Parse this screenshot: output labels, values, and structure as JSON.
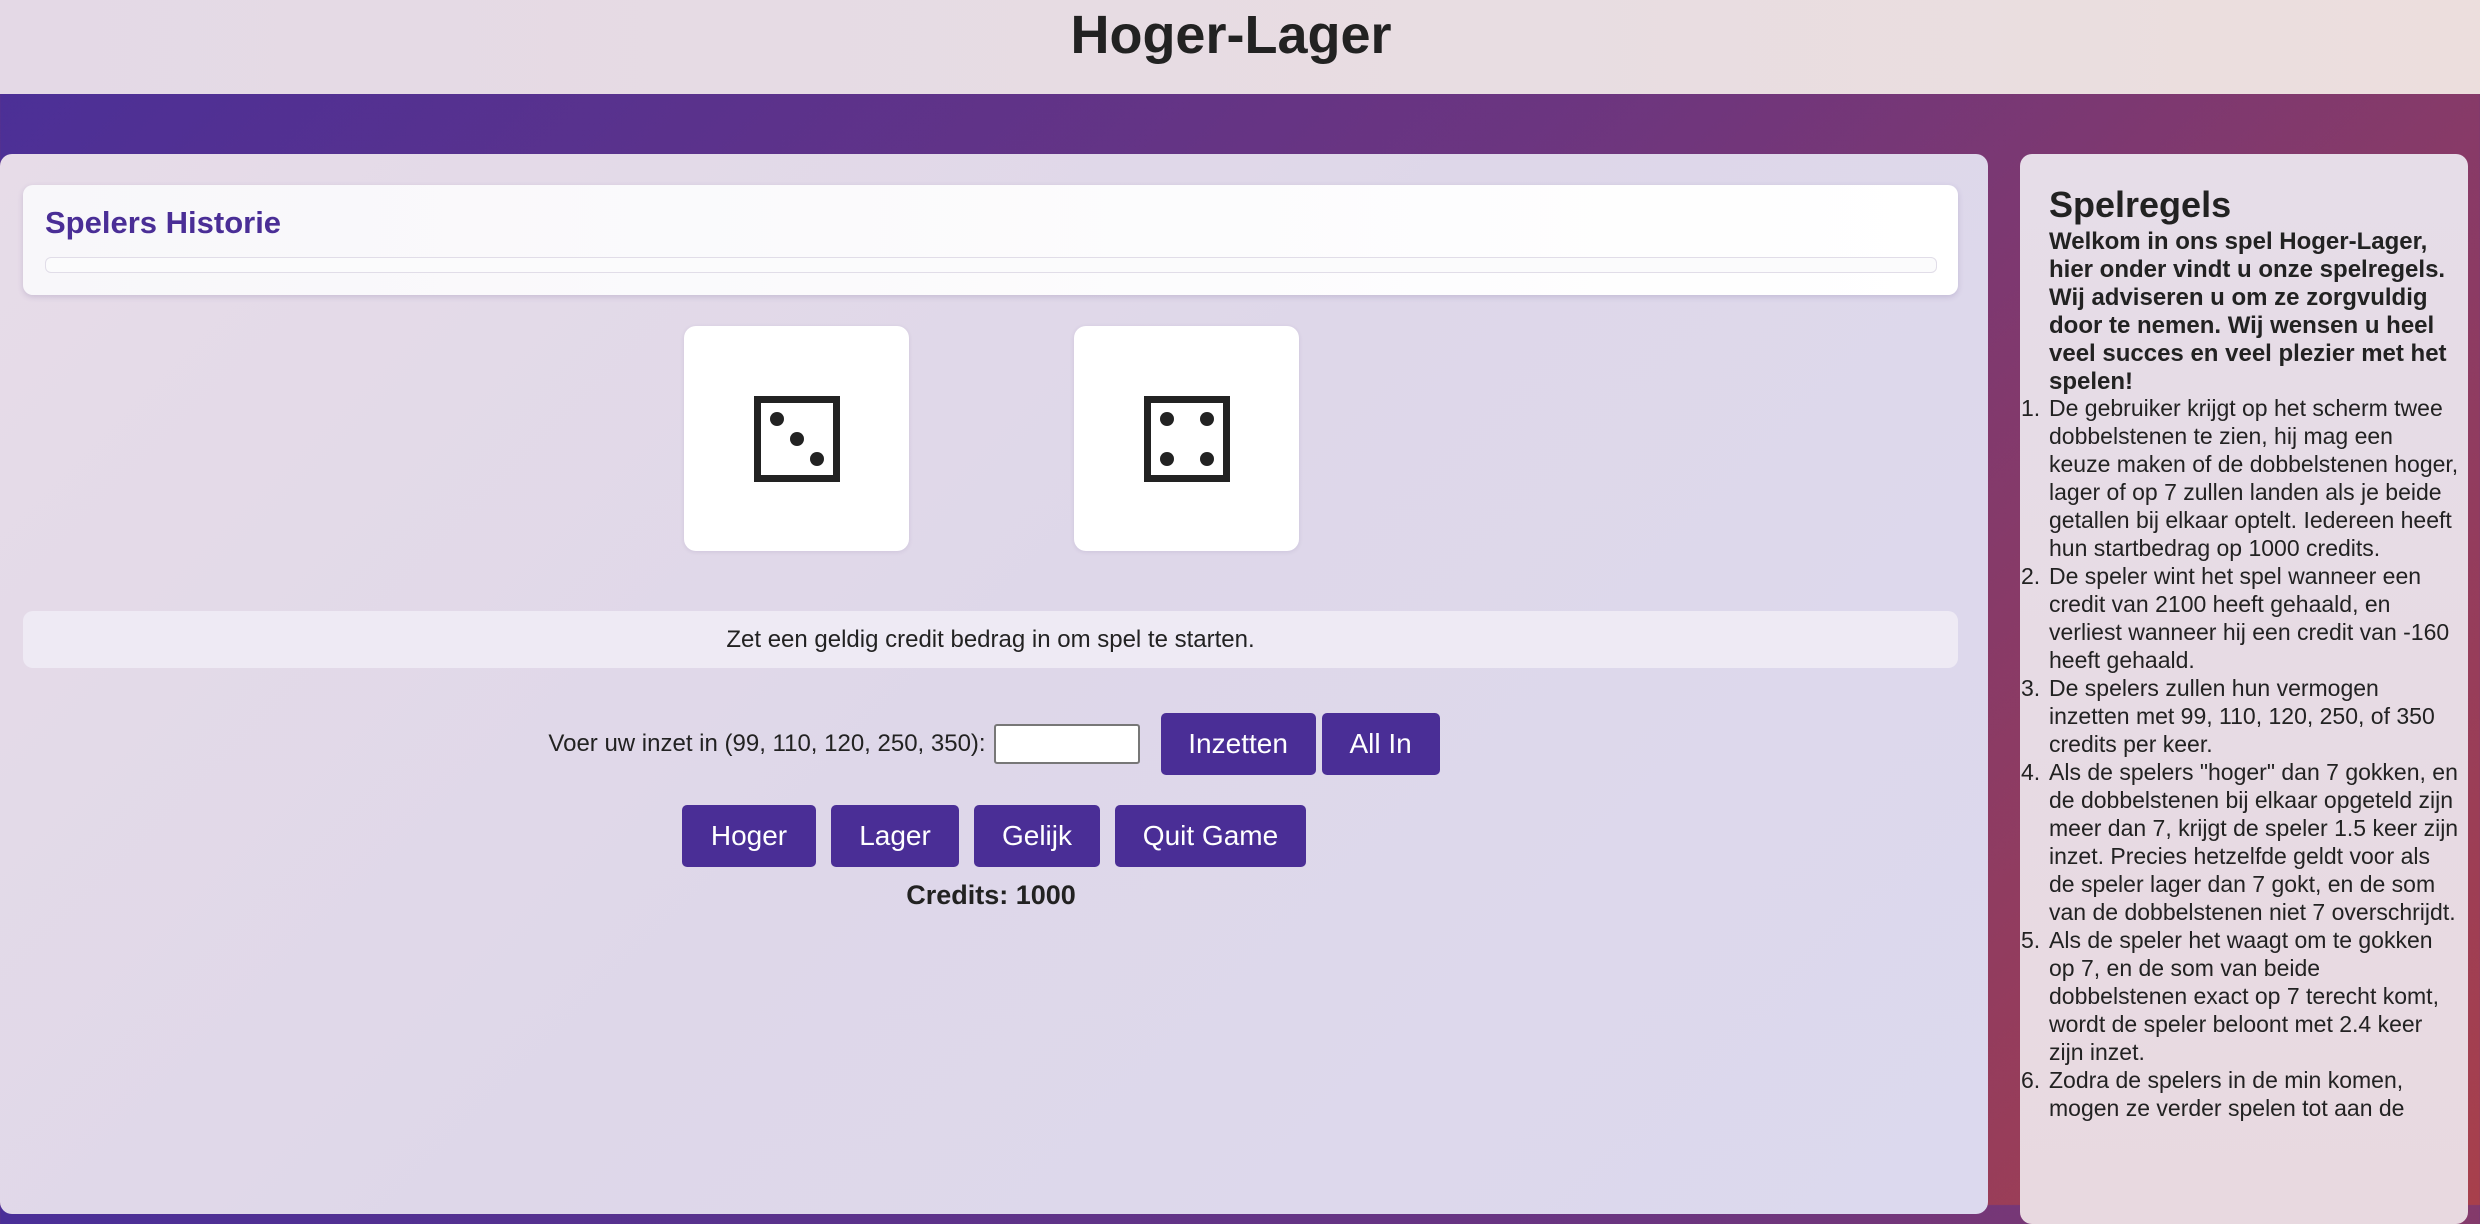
{
  "app": {
    "title": "Hoger-Lager"
  },
  "history": {
    "title": "Spelers Historie",
    "entries": []
  },
  "dice": [
    {
      "value": 3,
      "label": "die-three"
    },
    {
      "value": 4,
      "label": "die-four"
    }
  ],
  "status": {
    "message": "Zet een geldig credit bedrag in om spel te starten."
  },
  "bet": {
    "label": "Voer uw inzet in (99, 110, 120, 250, 350):",
    "value": "",
    "placeholder": "",
    "inzetten_label": "Inzetten",
    "allin_label": "All In"
  },
  "actions": {
    "hoger_label": "Hoger",
    "lager_label": "Lager",
    "gelijk_label": "Gelijk",
    "quit_label": "Quit Game"
  },
  "credits": {
    "text": "Credits: 1000"
  },
  "rules": {
    "title": "Spelregels",
    "intro": "Welkom in ons spel Hoger-Lager, hier onder vindt u onze spelregels. Wij adviseren u om ze zorgvuldig door te nemen. Wij wensen u heel veel succes en veel plezier met het spelen!",
    "items": [
      {
        "num": "1.",
        "text": "De gebruiker krijgt op het scherm twee dobbelstenen te zien, hij mag een keuze maken of de dobbelstenen hoger, lager of op 7 zullen landen als je beide getallen bij elkaar optelt. Iedereen heeft hun startbedrag op 1000 credits."
      },
      {
        "num": "2.",
        "text": "De speler wint het spel wanneer een credit van 2100 heeft gehaald, en verliest wanneer hij een credit van -160 heeft gehaald."
      },
      {
        "num": "3.",
        "text": "De spelers zullen hun vermogen inzetten met 99, 110, 120, 250, of 350 credits per keer."
      },
      {
        "num": "4.",
        "text": "Als de spelers \"hoger\" dan 7 gokken, en de dobbelstenen bij elkaar opgeteld zijn meer dan 7, krijgt de speler 1.5 keer zijn inzet. Precies hetzelfde geldt voor als de speler lager dan 7 gokt, en de som van de dobbelstenen niet 7 overschrijdt."
      },
      {
        "num": "5.",
        "text": "Als de speler het waagt om te gokken op 7, en de som van beide dobbelstenen exact op 7 terecht komt, wordt de speler beloont met 2.4 keer zijn inzet."
      },
      {
        "num": "6.",
        "text": "Zodra de spelers in de min komen, mogen ze verder spelen tot aan de"
      }
    ]
  }
}
